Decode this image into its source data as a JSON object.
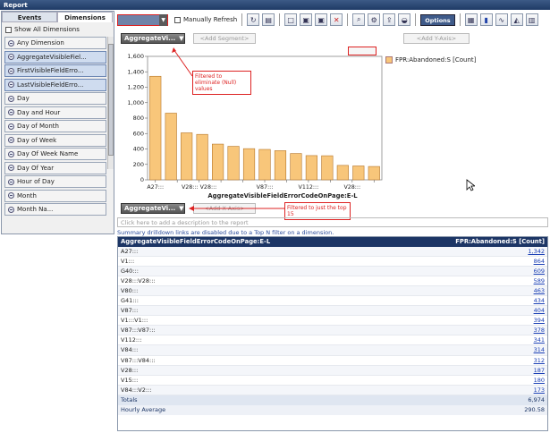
{
  "window": {
    "title": "Report"
  },
  "left_panel": {
    "tabs": [
      {
        "label": "Events"
      },
      {
        "label": "Dimensions"
      }
    ],
    "show_all": {
      "label": "Show All Dimensions",
      "checked": false
    },
    "dimensions": [
      {
        "label": "Any Dimension",
        "selected": false
      },
      {
        "label": "AggregateVisibleFiel...",
        "selected": true
      },
      {
        "label": "FirstVisibleFieldErro...",
        "selected": true
      },
      {
        "label": "LastVisibleFieldErro...",
        "selected": true
      },
      {
        "label": "Day",
        "selected": false
      },
      {
        "label": "Day and Hour",
        "selected": false
      },
      {
        "label": "Day of Month",
        "selected": false
      },
      {
        "label": "Day of Week",
        "selected": false
      },
      {
        "label": "Day Of Week Name",
        "selected": false
      },
      {
        "label": "Day Of Year",
        "selected": false
      },
      {
        "label": "Hour of Day",
        "selected": false
      },
      {
        "label": "Month",
        "selected": false
      },
      {
        "label": "Month Na...",
        "selected": false
      }
    ]
  },
  "toolbar": {
    "manual_refresh_label": "Manually Refresh",
    "options_label": "Options"
  },
  "chart_controls": {
    "segment_selector": "AggregateVi...",
    "add_segment": "<Add Segment>",
    "add_y_axis": "<Add Y-Axis>",
    "x_selector": "AggregateVi...",
    "add_x_axis": "<Add X-Axis>"
  },
  "annotations": {
    "null_filter": "Filtered to eliminate (Null) values",
    "top_filter": "Filtered to just the top 15"
  },
  "chart_data": {
    "type": "bar",
    "categories": [
      "A27:::",
      "V1:::",
      "G40:::",
      "V28:::V28:::",
      "V80:::",
      "G41:::",
      "V87:::",
      "V1:::V1:::",
      "V87:::V87:::",
      "V112:::",
      "V84:::",
      "V87:::V84:::",
      "V28:::",
      "V15:::",
      "V84:::V2:::"
    ],
    "x_tick_labels": [
      "A27:::",
      "",
      "V28::: V28:::",
      "",
      "",
      "V87:::",
      "",
      "V112:::",
      "",
      "V28:::",
      ""
    ],
    "values": [
      1342,
      864,
      609,
      589,
      463,
      434,
      404,
      394,
      378,
      341,
      314,
      312,
      187,
      180,
      173
    ],
    "xlabel": "AggregateVisibleFieldErrorCodeOnPage:E-L",
    "ylabel": "",
    "ylim": [
      0,
      1600
    ],
    "yticks": [
      0,
      200,
      400,
      600,
      800,
      1000,
      1200,
      1400,
      1600
    ],
    "ytick_labels": [
      "0",
      "200",
      "400",
      "600",
      "800",
      "1,000",
      "1,200",
      "1,400",
      "1,600"
    ],
    "legend": "FPR:Abandoned:S [Count]",
    "legend_position": "right",
    "bar_color": "#f8c67a",
    "bar_edge": "#b5762a",
    "grid": false
  },
  "description_placeholder": "Click here to add a description to the report",
  "summary_note": "Summary drilldown links are disabled due to a Top N filter on a dimension.",
  "table": {
    "columns": [
      "AggregateVisibleFieldErrorCodeOnPage:E-L",
      "FPR:Abandoned:S [Count]"
    ],
    "rows": [
      {
        "key": "A27:::",
        "value": "1,342"
      },
      {
        "key": "V1:::",
        "value": "864"
      },
      {
        "key": "G40:::",
        "value": "609"
      },
      {
        "key": "V28:::V28:::",
        "value": "589"
      },
      {
        "key": "V80:::",
        "value": "463"
      },
      {
        "key": "G41:::",
        "value": "434"
      },
      {
        "key": "V87:::",
        "value": "404"
      },
      {
        "key": "V1:::V1:::",
        "value": "394"
      },
      {
        "key": "V87:::V87:::",
        "value": "378"
      },
      {
        "key": "V112:::",
        "value": "341"
      },
      {
        "key": "V84:::",
        "value": "314"
      },
      {
        "key": "V87:::V84:::",
        "value": "312"
      },
      {
        "key": "V28:::",
        "value": "187"
      },
      {
        "key": "V15:::",
        "value": "180"
      },
      {
        "key": "V84:::V2:::",
        "value": "173"
      }
    ],
    "totals": {
      "label": "Totals",
      "value": "6,974"
    },
    "hourly_average": {
      "label": "Hourly Average",
      "value": "290.58"
    }
  }
}
